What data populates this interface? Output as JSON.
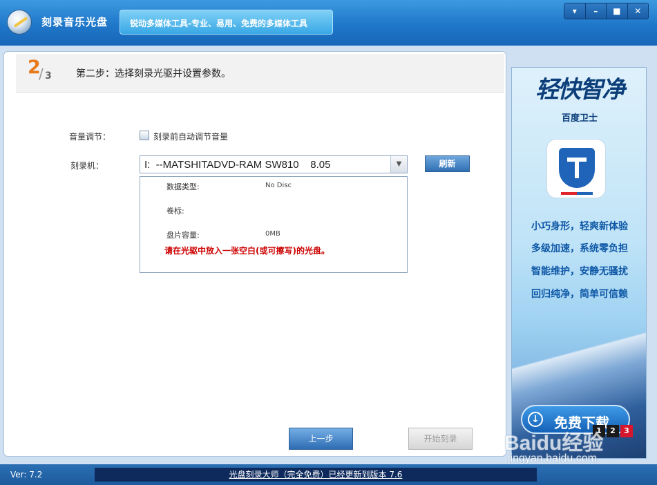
{
  "titlebar": {
    "app_title": "刻录音乐光盘",
    "slogan": "锐动多媒体工具-专业、易用、免费的多媒体工具",
    "window_buttons": [
      "▾",
      "–",
      "■",
      "✕"
    ]
  },
  "step": {
    "current": "2",
    "total": "3",
    "instruction": "第二步：选择刻录光驱并设置参数。"
  },
  "form": {
    "volume_label": "音量调节：",
    "auto_volume_checkbox_label": "刻录前自动调节音量",
    "auto_volume_checked": false,
    "burner_label": "刻录机：",
    "burner_selected": "I:  --MATSHITADVD-RAM SW810    8.05",
    "refresh_button": "刷新"
  },
  "disc_info": {
    "data_type_label": "数据类型:",
    "data_type_value": "No Disc",
    "volume_label_label": "卷标:",
    "volume_label_value": "",
    "capacity_label": "盘片容量:",
    "capacity_value": "0MB",
    "warning": "请在光驱中放入一张空白(或可擦写)的光盘。"
  },
  "buttons": {
    "prev": "上一步",
    "start_burn": "开始刻录"
  },
  "ad": {
    "headline": "轻快智净",
    "brand": "百度卫士",
    "features": [
      "小巧身形，轻爽新体验",
      "多级加速，系统零负担",
      "智能维护，安静无骚扰",
      "回归纯净，简单可信赖"
    ],
    "download_label": "免费下载",
    "pages": [
      "1",
      "2",
      "3"
    ],
    "active_page": "3"
  },
  "watermark": {
    "brand": "Baidu经验",
    "url": "jingyan.baidu.com"
  },
  "statusbar": {
    "version": "Ver: 7.2",
    "update_notice": "光盘刻录大师（完全免费）已经更新到版本 7.6"
  }
}
